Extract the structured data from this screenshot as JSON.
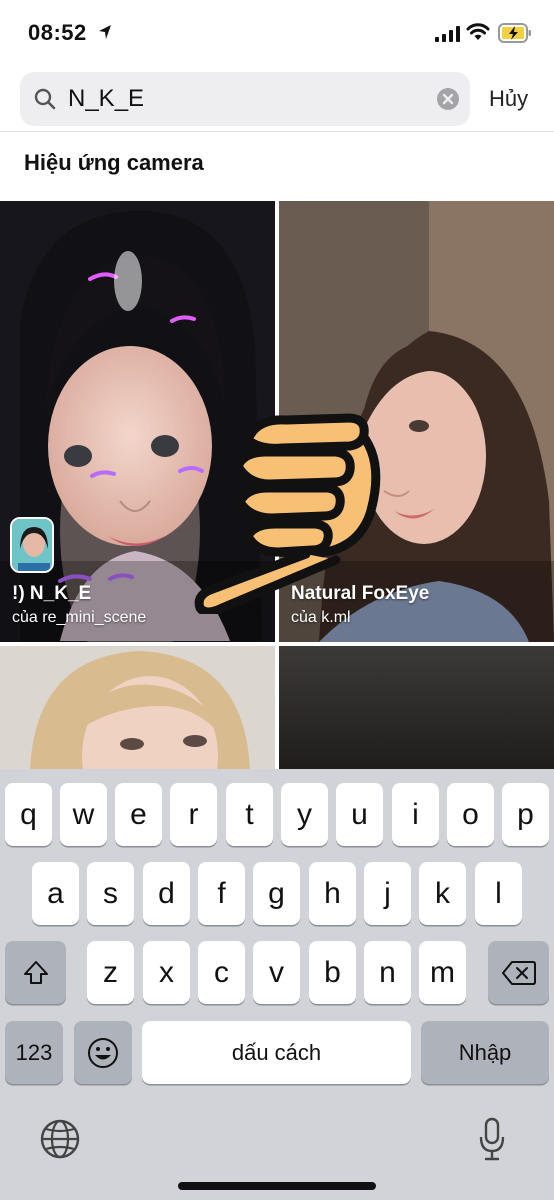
{
  "status_bar": {
    "time": "08:52"
  },
  "search": {
    "value": "N_K_E",
    "cancel_label": "Hủy"
  },
  "section_title": "Hiệu ứng camera",
  "effects": [
    {
      "title": "!) N_K_E",
      "author": "của re_mini_scene"
    },
    {
      "title": "Natural FoxEye",
      "author": "của k.ml"
    }
  ],
  "keyboard": {
    "row1": [
      "q",
      "w",
      "e",
      "r",
      "t",
      "y",
      "u",
      "i",
      "o",
      "p"
    ],
    "row2": [
      "a",
      "s",
      "d",
      "f",
      "g",
      "h",
      "j",
      "k",
      "l"
    ],
    "row3": [
      "z",
      "x",
      "c",
      "v",
      "b",
      "n",
      "m"
    ],
    "numbers_label": "123",
    "space_label": "dấu cách",
    "return_label": "Nhập"
  },
  "colors": {
    "hand": "#f8c074",
    "accent_purple": "#b86bff",
    "battery_charge": "#f4d03f"
  }
}
